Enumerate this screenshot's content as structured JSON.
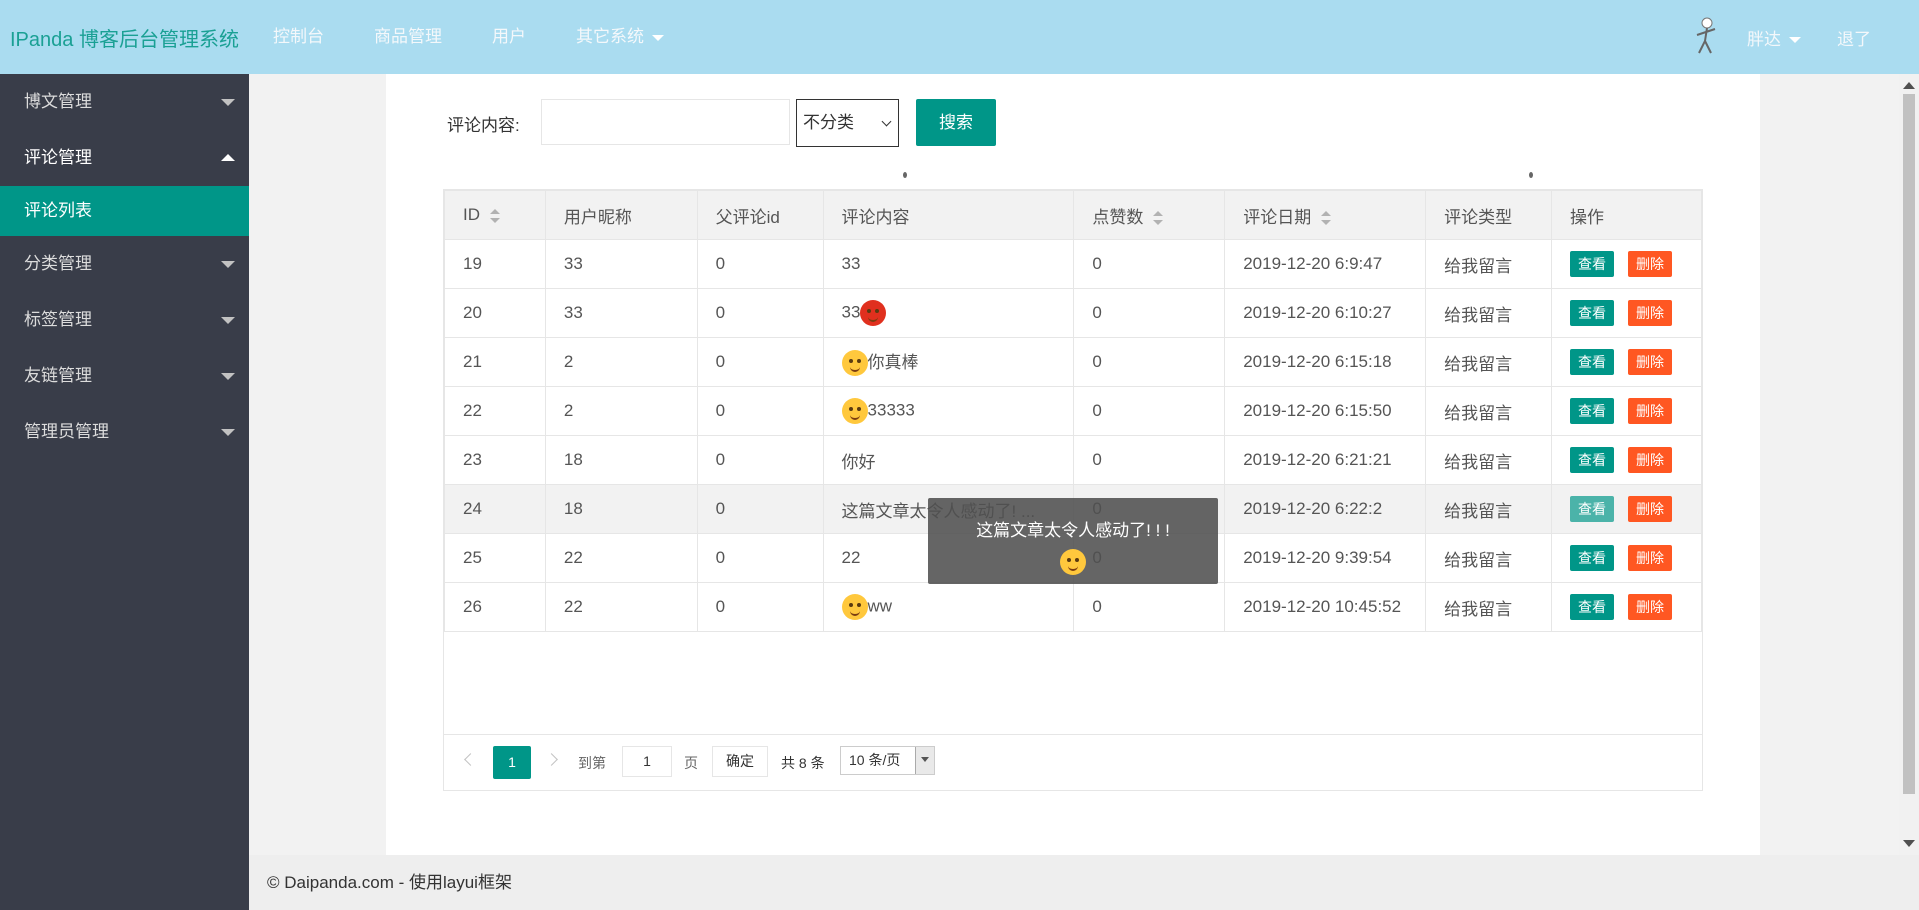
{
  "header": {
    "logo": "IPanda 博客后台管理系统",
    "nav": [
      "控制台",
      "商品管理",
      "用户",
      "其它系统"
    ],
    "user_name": "胖达",
    "logout": "退了"
  },
  "sidebar": {
    "items": [
      {
        "label": "博文管理",
        "state": "collapsed"
      },
      {
        "label": "评论管理",
        "state": "expanded"
      },
      {
        "label": "分类管理",
        "state": "collapsed"
      },
      {
        "label": "标签管理",
        "state": "collapsed"
      },
      {
        "label": "友链管理",
        "state": "collapsed"
      },
      {
        "label": "管理员管理",
        "state": "collapsed"
      }
    ],
    "active_sub": "评论列表"
  },
  "search": {
    "label": "评论内容:",
    "input_value": "",
    "select_value": "不分类",
    "button": "搜索"
  },
  "table": {
    "headers": [
      "ID",
      "用户昵称",
      "父评论id",
      "评论内容",
      "点赞数",
      "评论日期",
      "评论类型",
      "操作"
    ],
    "view_label": "查看",
    "delete_label": "删除",
    "rows": [
      {
        "id": "19",
        "nick": "33",
        "parent": "0",
        "content": "33",
        "emoji": "",
        "likes": "0",
        "date": "2019-12-20 6:9:47",
        "type": "给我留言"
      },
      {
        "id": "20",
        "nick": "33",
        "parent": "0",
        "content": "33",
        "emoji": "angry-face-icon",
        "likes": "0",
        "date": "2019-12-20 6:10:27",
        "type": "给我留言"
      },
      {
        "id": "21",
        "nick": "2",
        "parent": "0",
        "content": "你真棒",
        "emoji": "hug-face-icon",
        "likes": "0",
        "date": "2019-12-20 6:15:18",
        "type": "给我留言"
      },
      {
        "id": "22",
        "nick": "2",
        "parent": "0",
        "content": "33333",
        "emoji": "shocked-face-icon",
        "likes": "0",
        "date": "2019-12-20 6:15:50",
        "type": "给我留言"
      },
      {
        "id": "23",
        "nick": "18",
        "parent": "0",
        "content": "你好",
        "emoji": "",
        "likes": "0",
        "date": "2019-12-20 6:21:21",
        "type": "给我留言"
      },
      {
        "id": "24",
        "nick": "18",
        "parent": "0",
        "content": "这篇文章太令人感动了! ...",
        "emoji": "",
        "likes": "0",
        "date": "2019-12-20 6:22:2",
        "type": "给我留言"
      },
      {
        "id": "25",
        "nick": "22",
        "parent": "0",
        "content": "22",
        "emoji": "",
        "likes": "0",
        "date": "2019-12-20 9:39:54",
        "type": "给我留言"
      },
      {
        "id": "26",
        "nick": "22",
        "parent": "0",
        "content": "ww",
        "emoji": "laughing-face-icon",
        "likes": "0",
        "date": "2019-12-20 10:45:52",
        "type": "给我留言"
      }
    ]
  },
  "pager": {
    "current": "1",
    "goto_label": "到第",
    "goto_value": "1",
    "page_unit": "页",
    "confirm": "确定",
    "total": "共 8 条",
    "page_size": "10 条/页"
  },
  "tooltip": {
    "text": "这篇文章太令人感动了! ! !",
    "emoji": "hug-face-icon"
  },
  "footer": "© Daipanda.com - 使用layui框架",
  "colors": {
    "header_bg": "#aadcf0",
    "sidebar_bg": "#393d49",
    "accent": "#009688",
    "danger": "#ff5722"
  }
}
